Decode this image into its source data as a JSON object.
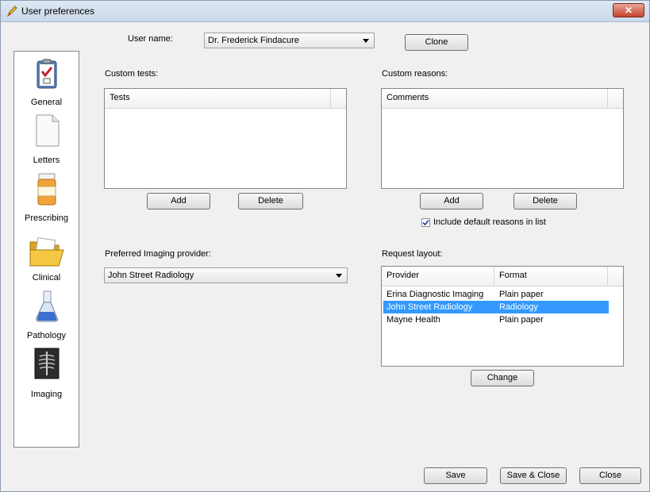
{
  "window": {
    "title": "User preferences",
    "close_label": "✕"
  },
  "user": {
    "label": "User name:",
    "value": "Dr. Frederick Findacure",
    "clone_label": "Clone"
  },
  "sidebar": {
    "items": [
      {
        "label": "General",
        "icon": "clipboard-icon"
      },
      {
        "label": "Letters",
        "icon": "document-icon"
      },
      {
        "label": "Prescribing",
        "icon": "pill-bottle-icon"
      },
      {
        "label": "Clinical",
        "icon": "folder-icon"
      },
      {
        "label": "Pathology",
        "icon": "flask-icon"
      },
      {
        "label": "Imaging",
        "icon": "xray-icon"
      }
    ]
  },
  "custom_tests": {
    "label": "Custom tests:",
    "header": "Tests",
    "add_label": "Add",
    "delete_label": "Delete"
  },
  "custom_reasons": {
    "label": "Custom reasons:",
    "header": "Comments",
    "add_label": "Add",
    "delete_label": "Delete",
    "include_default_label": "Include default reasons in list",
    "include_default_checked": true
  },
  "imaging": {
    "label": "Preferred Imaging provider:",
    "value": "John Street Radiology"
  },
  "request_layout": {
    "label": "Request layout:",
    "headers": [
      "Provider",
      "Format"
    ],
    "rows": [
      {
        "provider": "Erina Diagnostic Imaging",
        "format": "Plain paper"
      },
      {
        "provider": "John Street Radiology",
        "format": "Radiology"
      },
      {
        "provider": "Mayne Health",
        "format": "Plain paper"
      }
    ],
    "selected_index": 1,
    "change_label": "Change"
  },
  "footer": {
    "save_label": "Save",
    "save_close_label": "Save & Close",
    "close_label": "Close"
  },
  "colors": {
    "selection": "#3399ff",
    "titlebar": "#c9d7ea"
  }
}
